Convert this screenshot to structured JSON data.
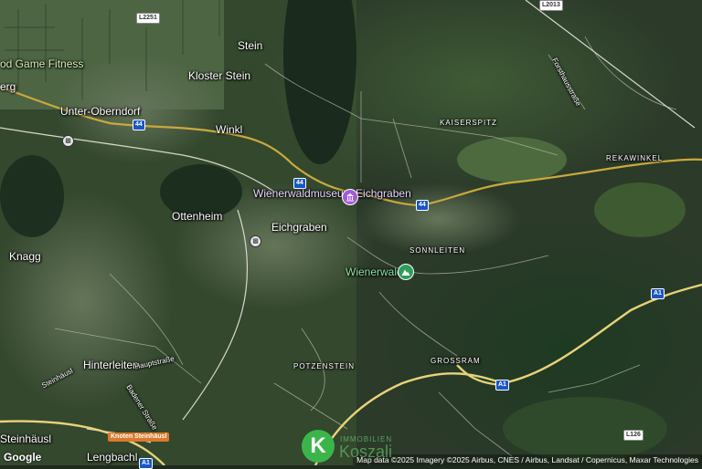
{
  "map": {
    "towns": [
      "Stein",
      "Kloster Stein",
      "Unter-Oberndorf",
      "Winkl",
      "Ottenheim",
      "Eichgraben",
      "Knagg",
      "Hinterleiten",
      "Steinhäusl",
      "Lengbachl",
      "erg"
    ],
    "localities": [
      "KAISERSPITZ",
      "REKAWINKEL",
      "SONNLEITEN",
      "GROSSRAM",
      "POTZENSTEIN"
    ],
    "streets": [
      "Forsthausstraße",
      "Hauptstraße",
      "Badener Straße",
      "Steinhäusl"
    ],
    "road_shields": [
      "L2251",
      "L2013",
      "44",
      "44",
      "44",
      "A1",
      "A1",
      "A1",
      "L126"
    ],
    "pois": [
      {
        "label": "Wienerwaldmuseum Eichgraben",
        "icon": "museum-icon",
        "color": "#a35bd6"
      },
      {
        "label": "Wienerwald",
        "icon": "mountain-icon",
        "color": "#2f9e5b"
      },
      {
        "label": "od Game Fitness"
      },
      {
        "label": "Knoten Steinhäusl"
      }
    ],
    "google_label": "Google",
    "attribution": "Map data ©2025 Imagery ©2025 Airbus, CNES / Airbus, Landsat / Copernicus, Maxar Technologies"
  },
  "brand": {
    "letter": "K",
    "top": "IMMOBILIEN",
    "name": "Koszali"
  }
}
